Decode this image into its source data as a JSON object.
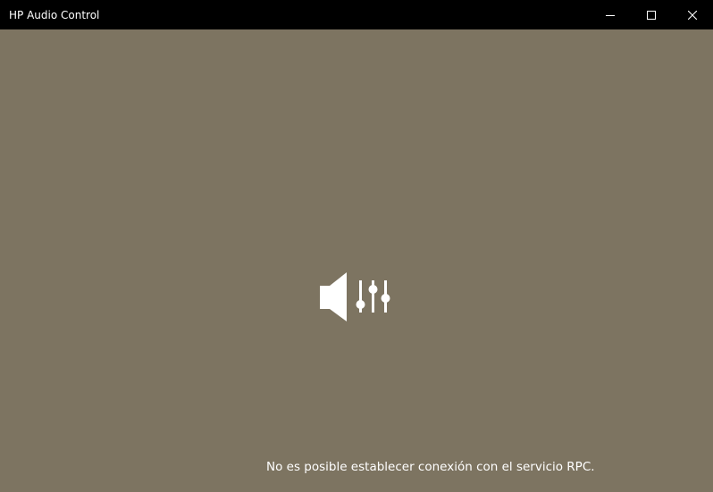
{
  "window": {
    "title": "HP Audio Control",
    "background_color": "#7d7461",
    "titlebar_color": "#000000"
  },
  "controls": {
    "minimize_icon": "minimize-icon",
    "maximize_icon": "maximize-icon",
    "close_icon": "close-icon"
  },
  "main": {
    "app_icon": "speaker-equalizer-icon",
    "status_message": "No es posible establecer conexión con el servicio RPC."
  }
}
